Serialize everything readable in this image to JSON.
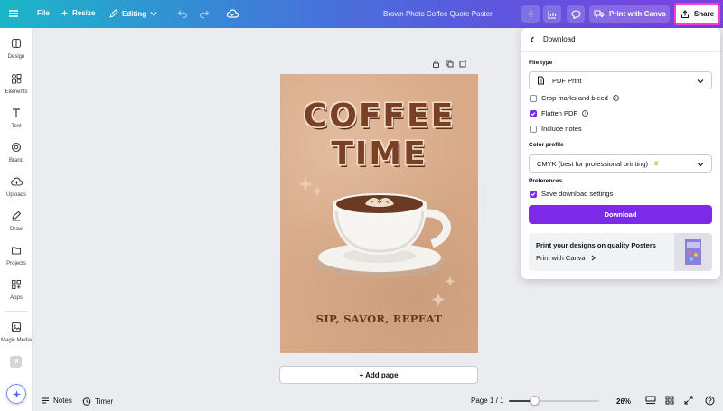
{
  "topbar": {
    "file_label": "File",
    "resize_label": "Resize",
    "editing_label": "Editing",
    "doc_title": "Brown Photo Coffee Quote Poster",
    "print_label": "Print with Canva",
    "share_label": "Share"
  },
  "sidebar": {
    "items": [
      {
        "label": "Design",
        "icon": "design-icon"
      },
      {
        "label": "Elements",
        "icon": "elements-icon"
      },
      {
        "label": "Text",
        "icon": "text-icon"
      },
      {
        "label": "Brand",
        "icon": "brand-icon"
      },
      {
        "label": "Uploads",
        "icon": "uploads-icon"
      },
      {
        "label": "Draw",
        "icon": "draw-icon"
      },
      {
        "label": "Projects",
        "icon": "projects-icon"
      },
      {
        "label": "Apps",
        "icon": "apps-icon"
      },
      {
        "label": "Magic Media",
        "icon": "magic-media-icon"
      }
    ],
    "extra_badge": "M"
  },
  "poster": {
    "line1": "COFFEE",
    "line2": "TIME",
    "subtitle": "SIP, SAVOR, REPEAT"
  },
  "canvas": {
    "add_page_label": "+ Add page"
  },
  "download_panel": {
    "title": "Download",
    "file_type_label": "File type",
    "file_type_value": "PDF Print",
    "options": [
      {
        "label": "Crop marks and bleed",
        "checked": false
      },
      {
        "label": "Flatten PDF",
        "checked": true
      },
      {
        "label": "Include notes",
        "checked": false
      }
    ],
    "color_profile_label": "Color profile",
    "color_profile_value": "CMYK (best for professional printing)",
    "preferences_label": "Preferences",
    "save_settings_label": "Save download settings",
    "save_settings_checked": true,
    "download_button": "Download",
    "promo_title": "Print your designs on quality Posters",
    "promo_link": "Print with Canva"
  },
  "bottombar": {
    "notes_label": "Notes",
    "timer_label": "Timer",
    "page_indicator": "Page 1 / 1",
    "zoom": "26%",
    "zoom_fraction": 0.26
  },
  "colors": {
    "accent": "#7d2ae8",
    "share_highlight": "#ff3bd6",
    "poster_bg": "#d8aa88",
    "poster_text": "#7a4024"
  }
}
